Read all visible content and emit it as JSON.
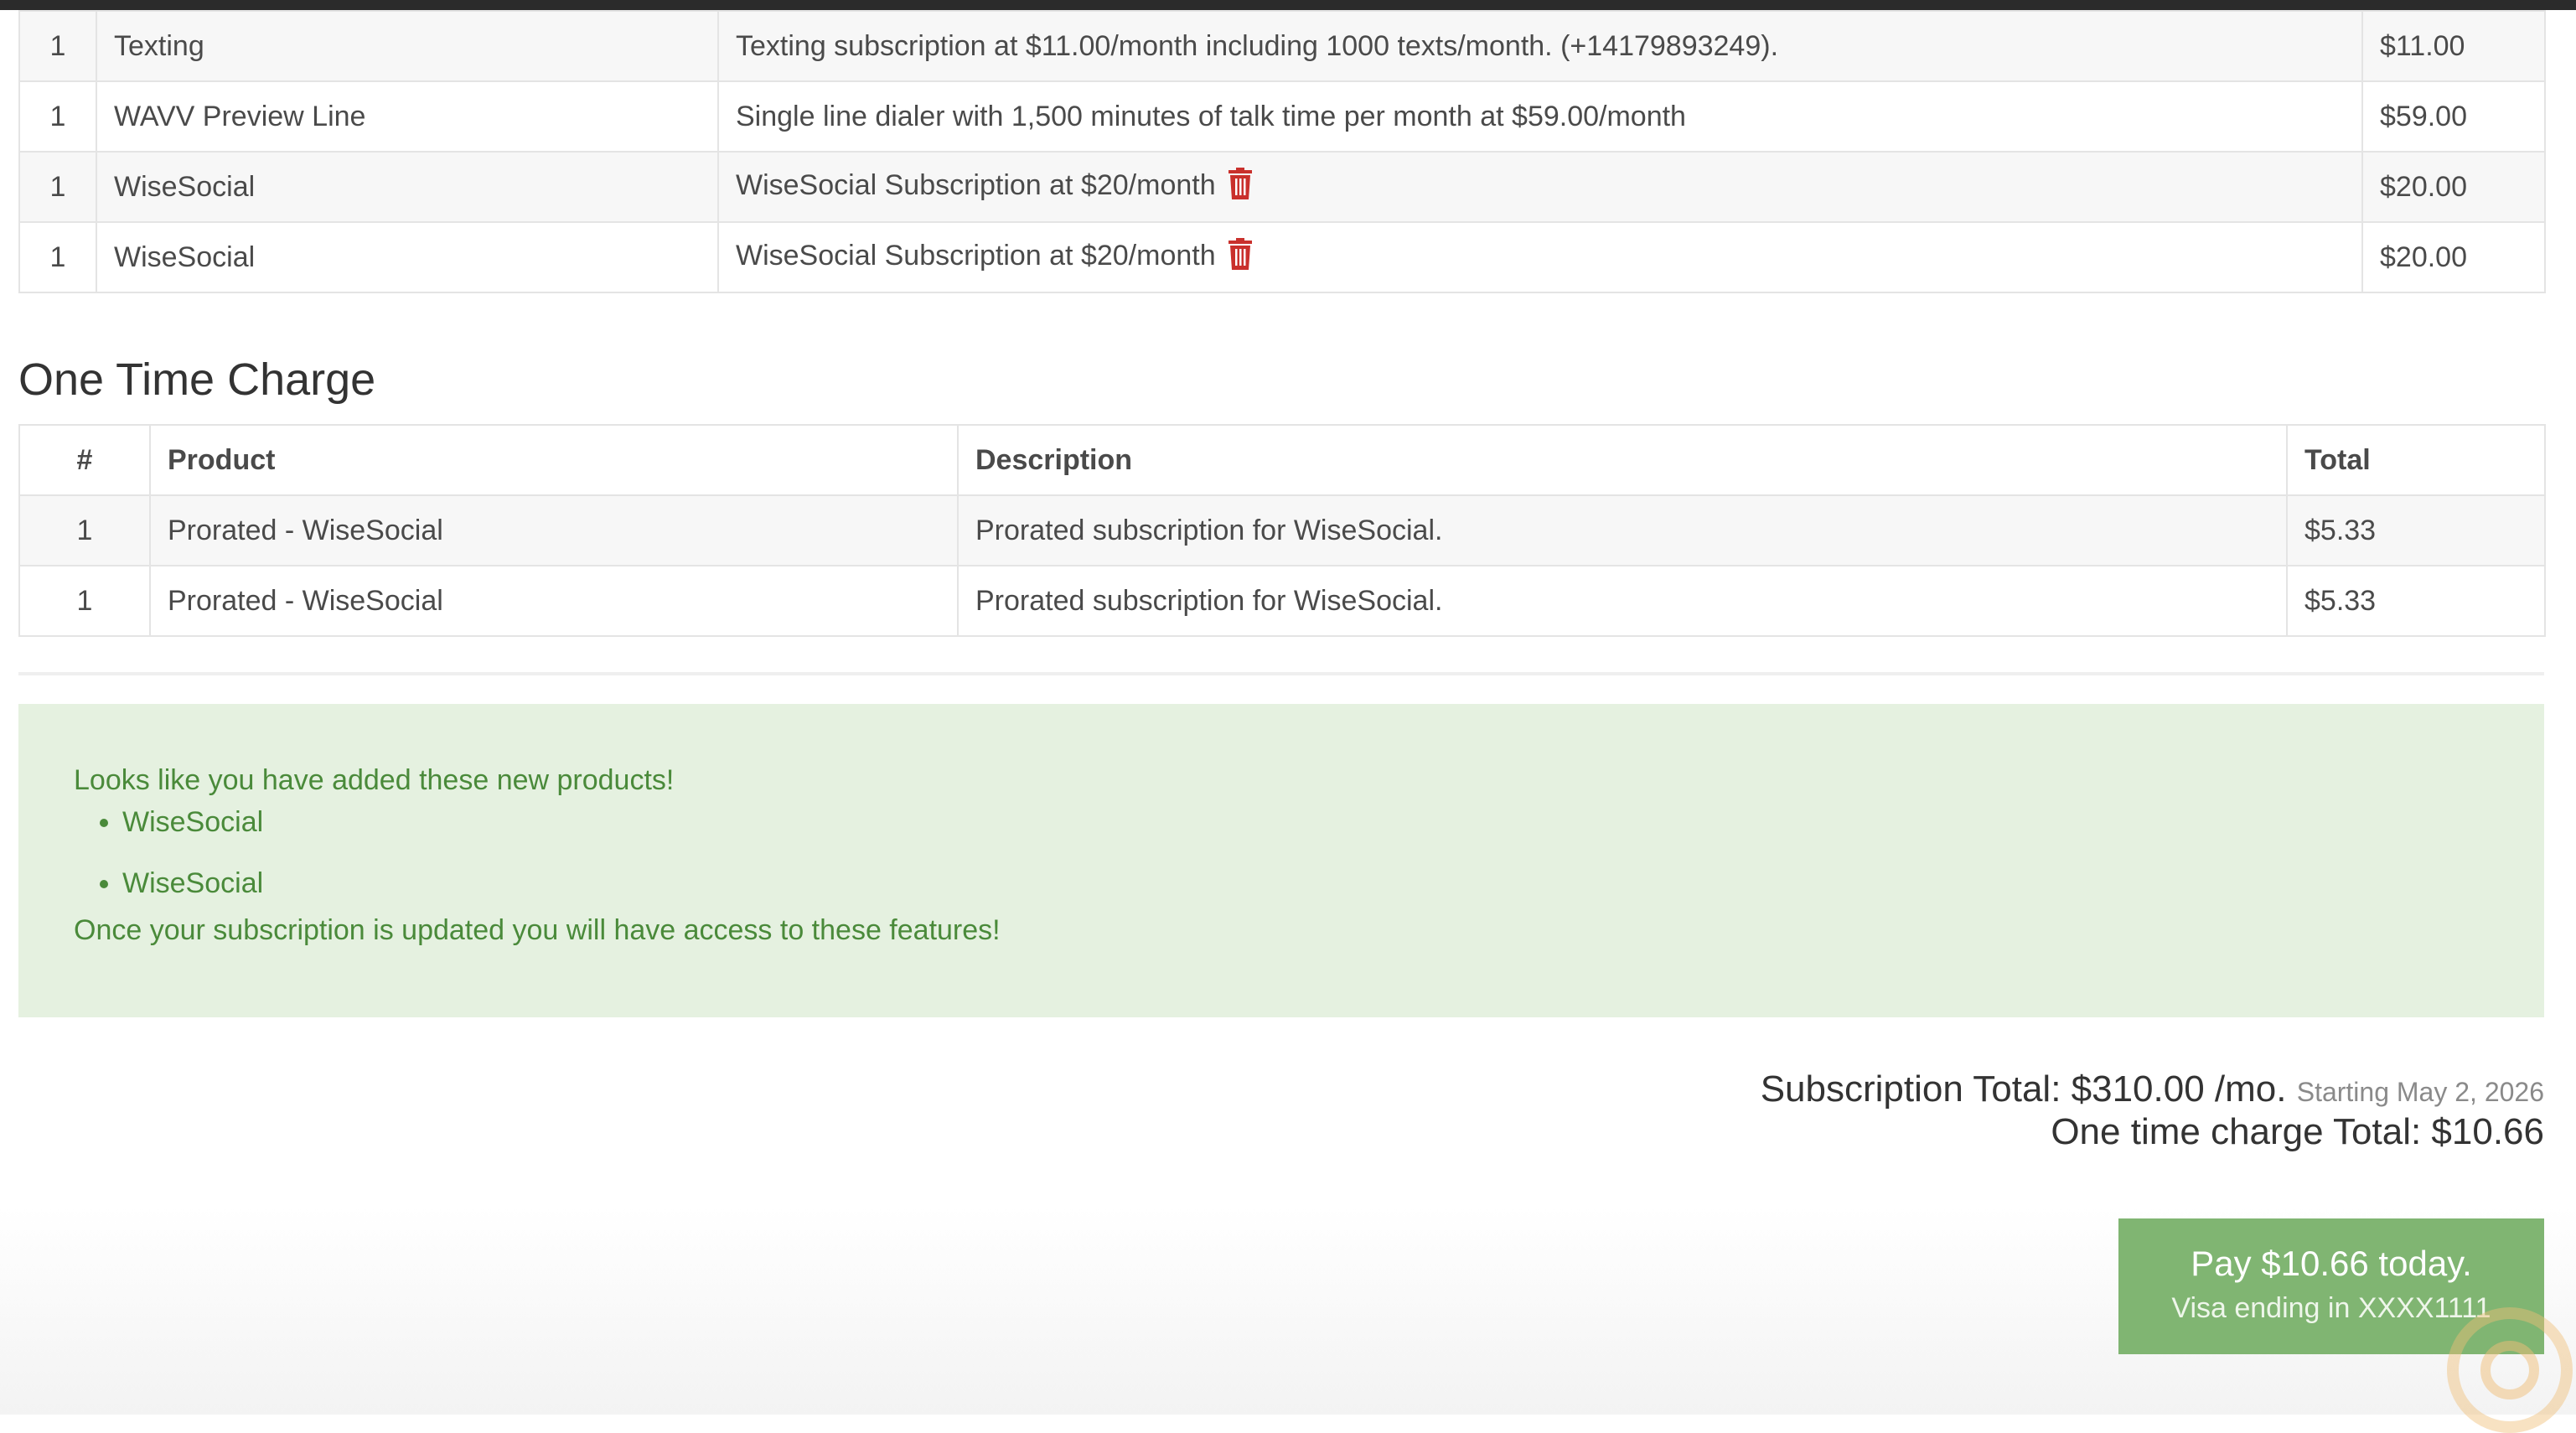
{
  "subscription_table": {
    "rows": [
      {
        "qty": "1",
        "product": "Texting",
        "description": "Texting subscription at $11.00/month including 1000 texts/month. (+14179893249).",
        "total": "$11.00",
        "deletable": false
      },
      {
        "qty": "1",
        "product": "WAVV Preview Line",
        "description": "Single line dialer with 1,500 minutes of talk time per month at $59.00/month",
        "total": "$59.00",
        "deletable": false
      },
      {
        "qty": "1",
        "product": "WiseSocial",
        "description": "WiseSocial Subscription at $20/month",
        "total": "$20.00",
        "deletable": true
      },
      {
        "qty": "1",
        "product": "WiseSocial",
        "description": "WiseSocial Subscription at $20/month",
        "total": "$20.00",
        "deletable": true
      }
    ]
  },
  "one_time": {
    "title": "One Time Charge",
    "headers": {
      "num": "#",
      "product": "Product",
      "description": "Description",
      "total": "Total"
    },
    "rows": [
      {
        "qty": "1",
        "product": "Prorated - WiseSocial",
        "description": "Prorated subscription for WiseSocial.",
        "total": "$5.33"
      },
      {
        "qty": "1",
        "product": "Prorated - WiseSocial",
        "description": "Prorated subscription for WiseSocial.",
        "total": "$5.33"
      }
    ]
  },
  "notice": {
    "intro": "Looks like you have added these new products!",
    "items": [
      "WiseSocial",
      "WiseSocial"
    ],
    "outro": "Once your subscription is updated you will have access to these features!"
  },
  "totals": {
    "subscription": "Subscription Total: $310.00 /mo.",
    "starting": "Starting May 2, 2026",
    "one_time": "One time charge Total: $10.66"
  },
  "pay_button": {
    "line1": "Pay $10.66 today.",
    "line2": "Visa ending in XXXX1111"
  },
  "colors": {
    "accent": "#80b572",
    "notice_bg": "#e5f1e0",
    "notice_text": "#4a8a3a",
    "trash": "#c9302c"
  },
  "icons": {
    "delete": "trash-icon"
  }
}
